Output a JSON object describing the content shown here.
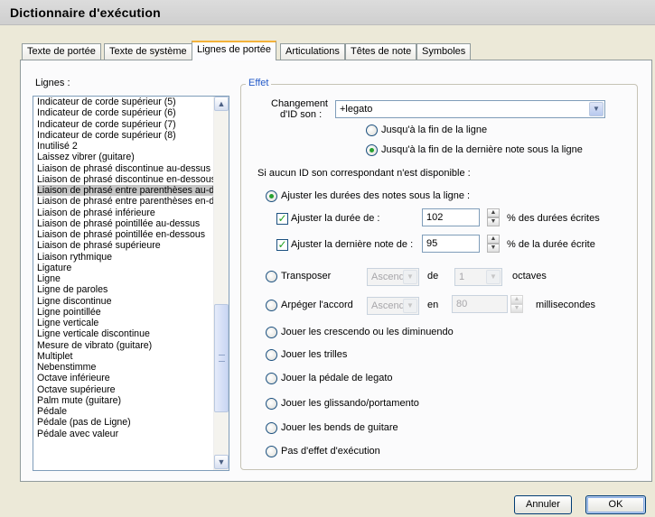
{
  "window": {
    "title": "Dictionnaire d'exécution"
  },
  "tabs": [
    "Texte de portée",
    "Texte de système",
    "Lignes de portée",
    "Articulations",
    "Têtes de note",
    "Symboles"
  ],
  "lines": {
    "label": "Lignes :",
    "items": [
      "Indicateur de corde supérieur (5)",
      "Indicateur de corde supérieur (6)",
      "Indicateur de corde supérieur (7)",
      "Indicateur de corde supérieur (8)",
      "Inutilisé 2",
      "Laissez vibrer (guitare)",
      "Liaison de phrasé discontinue au-dessus",
      "Liaison de phrasé discontinue en-dessous",
      "Liaison de phrasé entre parenthèses au-dessus",
      "Liaison de phrasé entre parenthèses en-dessous",
      "Liaison de phrasé inférieure",
      "Liaison de phrasé pointillée au-dessus",
      "Liaison de phrasé pointillée en-dessous",
      "Liaison de phrasé supérieure",
      "Liaison rythmique",
      "Ligature",
      "Ligne",
      "Ligne de paroles",
      "Ligne discontinue",
      "Ligne pointillée",
      "Ligne verticale",
      "Ligne verticale discontinue",
      "Mesure de vibrato (guitare)",
      "Multiplet",
      "Nebenstimme",
      "Octave inférieure",
      "Octave supérieure",
      "Palm mute (guitare)",
      "Pédale",
      "Pédale (pas de Ligne)",
      "Pédale avec valeur"
    ],
    "selected_index": 8
  },
  "effect": {
    "legend": "Effet",
    "sound_id_label_1": "Changement",
    "sound_id_label_2": "d'ID son :",
    "sound_id_value": "+legato",
    "end_of_line": "Jusqu'à la fin de la ligne",
    "end_of_last_note": "Jusqu'à la fin de la dernière note sous la ligne",
    "no_id_text": "Si aucun ID son correspondant n'est disponible :",
    "adjust_durations": "Ajuster les durées des notes sous la ligne :",
    "adjust_duration_label": "Ajuster la durée de :",
    "adjust_duration_value": "102",
    "adjust_duration_unit": "% des durées écrites",
    "adjust_last_label": "Ajuster la dernière note de :",
    "adjust_last_value": "95",
    "adjust_last_unit": "% de la durée écrite",
    "transpose": "Transposer",
    "transpose_dir": "Ascend",
    "transpose_de": "de",
    "transpose_amount": "1",
    "transpose_unit": "octaves",
    "arpeggio": "Arpéger l'accord",
    "arpeggio_dir": "Ascend",
    "arpeggio_en": "en",
    "arpeggio_ms": "80",
    "arpeggio_unit": "millisecondes",
    "crescendo": "Jouer les crescendo ou les diminuendo",
    "trills": "Jouer les trilles",
    "legato_pedal": "Jouer la pédale de legato",
    "glissando": "Jouer les glissando/portamento",
    "bends": "Jouer les bends de guitare",
    "no_effect": "Pas d'effet d'exécution"
  },
  "buttons": {
    "cancel": "Annuler",
    "ok": "OK"
  },
  "colors": {
    "legend": "#2259c8",
    "radio_dot": "#27a130",
    "check_mark": "#21a121",
    "active_tab_accent": "#f3b23a"
  }
}
